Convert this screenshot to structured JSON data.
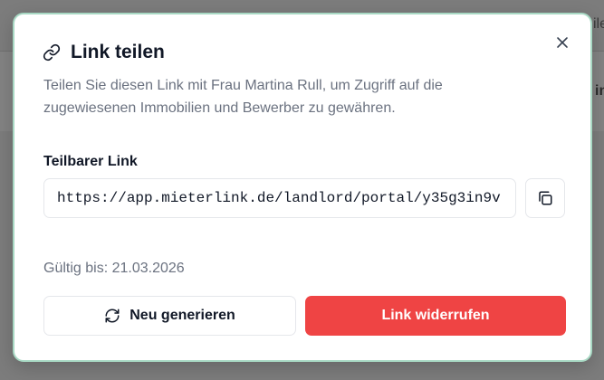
{
  "background": {
    "partial_text_top": "ile",
    "partial_text_band": "in"
  },
  "dialog": {
    "title": "Link teilen",
    "title_icon": "link-icon",
    "close_icon": "close-icon",
    "description": "Teilen Sie diesen Link mit Frau Martina Rull, um Zugriff auf die zugewiesenen Immobilien und Bewerber zu gewähren.",
    "field_label": "Teilbarer Link",
    "link_value": "https://app.mieterlink.de/landlord/portal/y35g3in9v",
    "copy_icon": "copy-icon",
    "valid_until": "Gültig bis: 21.03.2026",
    "regenerate_label": "Neu generieren",
    "regenerate_icon": "refresh-icon",
    "revoke_label": "Link widerrufen",
    "colors": {
      "accent_border": "#a8d9c4",
      "danger": "#ef4444",
      "muted_text": "#6b7280"
    }
  }
}
